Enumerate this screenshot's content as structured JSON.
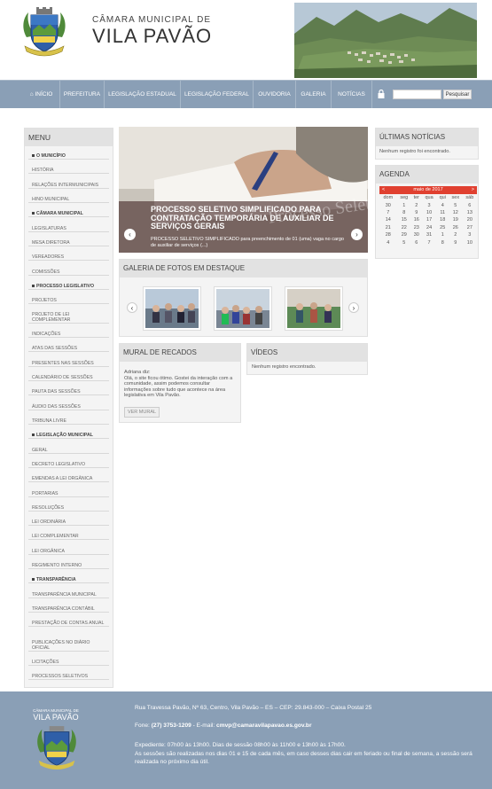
{
  "header": {
    "title_small": "CÂMARA MUNICIPAL DE",
    "title_big": "VILA PAVÃO"
  },
  "nav": {
    "home": "INÍCIO",
    "items": [
      "PREFEITURA",
      "LEGISLAÇÃO ESTADUAL",
      "LEGISLAÇÃO FEDERAL",
      "OUVIDORIA",
      "GALERIA",
      "NOTÍCIAS"
    ],
    "search_button": "Pesquisar",
    "search_value": ""
  },
  "menu": {
    "title": "MENU",
    "items": [
      {
        "label": "O MUNICÍPIO",
        "head": true
      },
      {
        "label": "HISTÓRIA"
      },
      {
        "label": "RELAÇÕES INTERMUNICIPAIS"
      },
      {
        "label": "HINO MUNICIPAL"
      },
      {
        "label": "CÂMARA MUNICIPAL",
        "head": true
      },
      {
        "label": "LEGISLATURAS"
      },
      {
        "label": "MESA DIRETORA"
      },
      {
        "label": "VEREADORES"
      },
      {
        "label": "COMISSÕES"
      },
      {
        "label": "PROCESSO LEGISLATIVO",
        "head": true
      },
      {
        "label": "PROJETOS"
      },
      {
        "label": "PROJETO DE LEI COMPLEMENTAR"
      },
      {
        "label": "INDICAÇÕES"
      },
      {
        "label": "ATAS DAS SESSÕES"
      },
      {
        "label": "PRESENTES NAS SESSÕES"
      },
      {
        "label": "CALENDÁRIO DE SESSÕES"
      },
      {
        "label": "PAUTA DAS SESSÕES"
      },
      {
        "label": "ÁUDIO DAS SESSÕES"
      },
      {
        "label": "TRIBUNA LIVRE"
      },
      {
        "label": "LEGISLAÇÃO MUNICIPAL",
        "head": true
      },
      {
        "label": "GERAL"
      },
      {
        "label": "DECRETO LEGISLATIVO"
      },
      {
        "label": "EMENDAS A LEI ORGÂNICA"
      },
      {
        "label": "PORTARIAS"
      },
      {
        "label": "RESOLUÇÕES"
      },
      {
        "label": "LEI ORDINÁRIA"
      },
      {
        "label": "LEI COMPLEMENTAR"
      },
      {
        "label": "LEI ORGÂNICA"
      },
      {
        "label": "REGIMENTO INTERNO"
      },
      {
        "label": "TRANSPARÊNCIA",
        "head": true
      },
      {
        "label": "TRANSPARÊNCIA MUNICIPAL"
      },
      {
        "label": "TRANSPARÊNCIA CONTÁBIL"
      },
      {
        "label": "PRESTAÇÃO DE CONTAS ANUAL"
      },
      {
        "label": "PUBLICAÇÕES NO DIÁRIO OFICIAL"
      },
      {
        "label": "LICITAÇÕES"
      },
      {
        "label": "PROCESSOS SELETIVOS"
      }
    ]
  },
  "slider": {
    "headline": "PROCESSO SELETIVO SIMPLIFICADO PARA CONTRATAÇÃO TEMPORÁRIA DE AUXILIAR DE SERVIÇOS GERAIS",
    "excerpt": "PROCESSO SELETIVO SIMPLIFICADO para preenchimento de 01 (uma) vaga no cargo de auxiliar de serviços (...)",
    "watermark": "Processo Seletivo"
  },
  "gallery": {
    "title": "GALERIA DE FOTOS EM DESTAQUE"
  },
  "mural": {
    "title": "MURAL DE RECADOS",
    "author": "Adriana diz:",
    "message": "Olá, o site ficou ótimo. Gostei da interação com a comunidade, assim podemos consultar informações sobre tudo que acontece na área legislativa em Vila Pavão.",
    "button": "VER MURAL"
  },
  "videos": {
    "title": "VÍDEOS",
    "empty": "Nenhum registro encontrado."
  },
  "news": {
    "title": "ÚLTIMAS NOTÍCIAS",
    "empty": "Nenhum registro foi encontrado."
  },
  "agenda": {
    "title": "AGENDA",
    "month": "maio de 2017",
    "weekdays": [
      "dom",
      "seg",
      "ter",
      "qua",
      "qui",
      "sex",
      "sáb"
    ],
    "weeks": [
      [
        "30",
        "1",
        "2",
        "3",
        "4",
        "5",
        "6"
      ],
      [
        "7",
        "8",
        "9",
        "10",
        "11",
        "12",
        "13"
      ],
      [
        "14",
        "15",
        "16",
        "17",
        "18",
        "19",
        "20"
      ],
      [
        "21",
        "22",
        "23",
        "24",
        "25",
        "26",
        "27"
      ],
      [
        "28",
        "29",
        "30",
        "31",
        "1",
        "2",
        "3"
      ],
      [
        "4",
        "5",
        "6",
        "7",
        "8",
        "9",
        "10"
      ]
    ]
  },
  "footer": {
    "logo_small": "CÂMARA MUNICIPAL DE",
    "logo_big": "VILA PAVÃO",
    "address": "Rua Travessa Pavão, Nº 63, Centro, Vila Pavão – ES – CEP: 29.843-000 – Caixa Postal 25",
    "phone_label": "Fone:",
    "phone": "(27) 3753-1209",
    "email_label": "- E-mail:",
    "email": "cmvp@camaravilapavao.es.gov.br",
    "hours_label": "Expediente:",
    "hours_text": "07h00 às 13h00. Dias de sessão 08h00 às 11h00 e 13h00 às 17h00.",
    "sessions_text": "As sessões são realizadas nos dias 01 e 15 de cada mês, em caso desses dias cair em feriado ou final de semana, a sessão será realizada no próximo dia útil."
  },
  "colors": {
    "nav": "#8a9fb6",
    "footer": "#8a9fb6",
    "calendar_accent": "#e04030",
    "panel_bg": "#f4f4f4"
  }
}
